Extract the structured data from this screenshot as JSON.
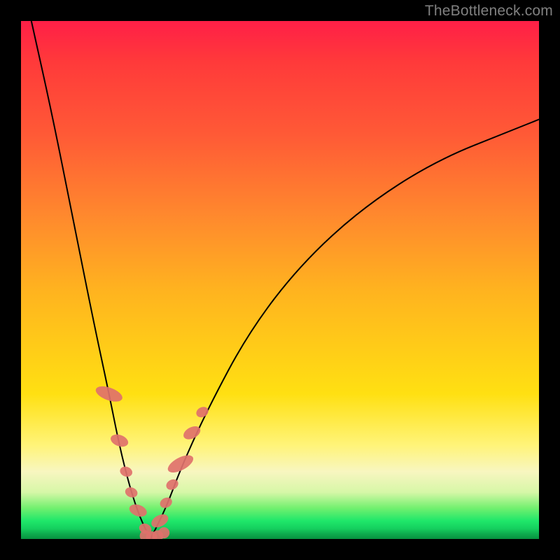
{
  "watermark": "TheBottleneck.com",
  "colors": {
    "bead": "#e0716b",
    "curve": "#000000",
    "frame": "#000000"
  },
  "chart_data": {
    "type": "line",
    "title": "",
    "xlabel": "",
    "ylabel": "",
    "xlim": [
      0,
      100
    ],
    "ylim": [
      0,
      100
    ],
    "grid": false,
    "legend": false,
    "note": "V-shaped bottleneck curve on red→green gradient; minimum ≈ x=25, y≈0. Left arm steep, right arm shallow. Coral beads cluster near the valley on both arms.",
    "series": [
      {
        "name": "left-arm",
        "x": [
          2,
          6,
          10,
          14,
          17,
          19,
          21,
          23,
          25
        ],
        "y": [
          100,
          82,
          62,
          42,
          28,
          18,
          10,
          4,
          0
        ]
      },
      {
        "name": "right-arm",
        "x": [
          25,
          28,
          31,
          36,
          44,
          54,
          66,
          80,
          95,
          100
        ],
        "y": [
          0,
          6,
          14,
          25,
          40,
          53,
          64,
          73,
          79,
          81
        ]
      }
    ],
    "beads_left": [
      {
        "x": 17.0,
        "y": 28,
        "size": "long"
      },
      {
        "x": 19.0,
        "y": 19,
        "size": "med"
      },
      {
        "x": 20.3,
        "y": 13,
        "size": "small"
      },
      {
        "x": 21.3,
        "y": 9,
        "size": "small"
      },
      {
        "x": 22.6,
        "y": 5.5,
        "size": "med"
      },
      {
        "x": 24.0,
        "y": 2.0,
        "size": "small"
      }
    ],
    "beads_right": [
      {
        "x": 26.8,
        "y": 3.5,
        "size": "med"
      },
      {
        "x": 28.0,
        "y": 7.0,
        "size": "small"
      },
      {
        "x": 29.2,
        "y": 10.5,
        "size": "small"
      },
      {
        "x": 30.8,
        "y": 14.5,
        "size": "long"
      },
      {
        "x": 33.0,
        "y": 20.5,
        "size": "med"
      },
      {
        "x": 35.0,
        "y": 24.5,
        "size": "small"
      }
    ],
    "beads_bottom": [
      {
        "x": 24.0,
        "y": 0.6
      },
      {
        "x": 25.2,
        "y": 0.4
      },
      {
        "x": 26.4,
        "y": 0.6
      },
      {
        "x": 27.6,
        "y": 1.2
      }
    ]
  }
}
